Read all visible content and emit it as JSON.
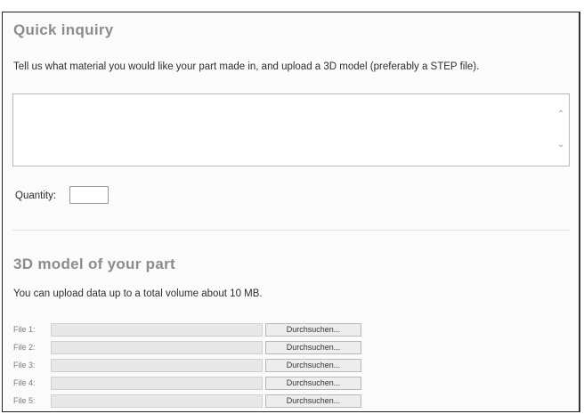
{
  "quick_inquiry": {
    "title": "Quick inquiry",
    "instructions": "Tell us what material you would like your part made in, and upload a 3D model (preferably a STEP file).",
    "textarea_value": "",
    "quantity_label": "Quantity:",
    "quantity_value": ""
  },
  "model_section": {
    "title": "3D model of your part",
    "note": "You can upload data up to a total volume about 10 MB.",
    "files": [
      {
        "label": "File 1:",
        "button": "Durchsuchen..."
      },
      {
        "label": "File 2:",
        "button": "Durchsuchen..."
      },
      {
        "label": "File 3:",
        "button": "Durchsuchen..."
      },
      {
        "label": "File 4:",
        "button": "Durchsuchen..."
      },
      {
        "label": "File 5:",
        "button": "Durchsuchen..."
      }
    ]
  },
  "icons": {
    "scroll_up": "chevron-up-icon",
    "scroll_down": "chevron-down-icon"
  },
  "colors": {
    "heading": "#8c8c8c",
    "text": "#2e2e2e",
    "border": "#b9b9b9"
  }
}
